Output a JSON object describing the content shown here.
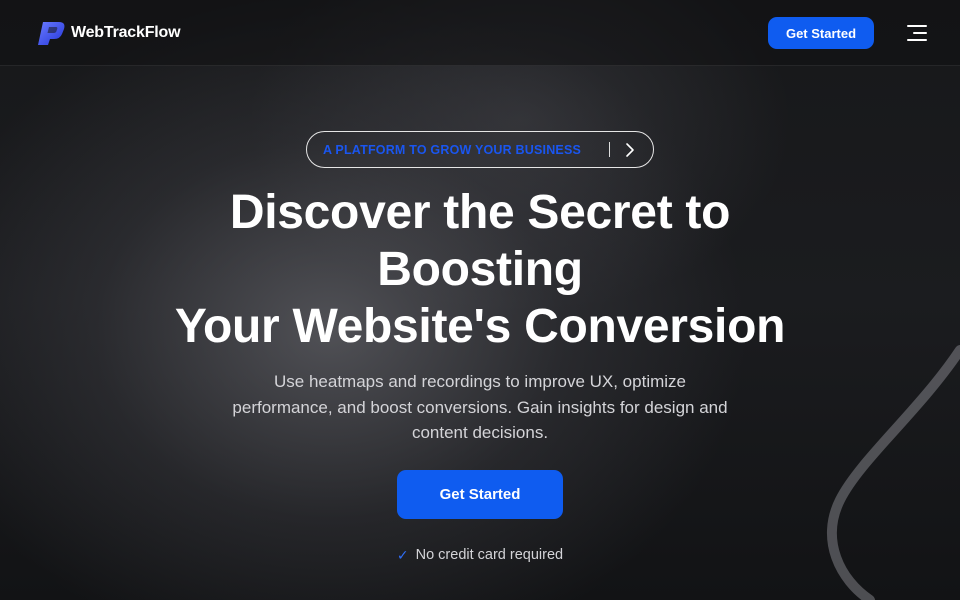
{
  "header": {
    "brand": "WebTrackFlow",
    "cta_label": "Get Started",
    "menu_icon": "hamburger-menu-icon"
  },
  "hero": {
    "eyebrow": "A PLATFORM TO GROW YOUR BUSINESS",
    "eyebrow_icon": "chevron-right-icon",
    "headline_lines": [
      "Discover the Secret to",
      "Boosting",
      "Your Website's Conversion"
    ],
    "subtext": "Use heatmaps and recordings to improve UX, optimize performance, and boost conversions. Gain insights for design and content decisions.",
    "cta_label": "Get Started",
    "note": "No credit card required",
    "note_icon": "checkmark-icon"
  },
  "colors": {
    "accent": "#0f5cf0",
    "eyebrow_text": "#1a56f0",
    "background": "#141517"
  }
}
